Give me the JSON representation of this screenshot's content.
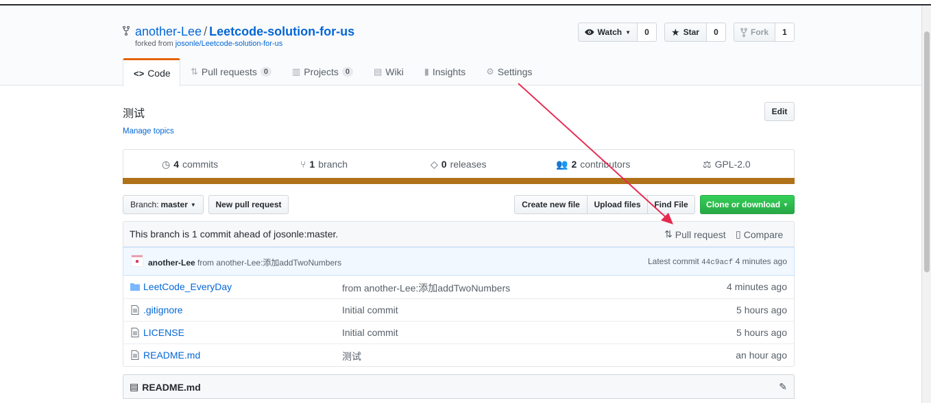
{
  "repo": {
    "owner": "another-Lee",
    "separator": "/",
    "name": "Leetcode-solution-for-us",
    "forked_prefix": "forked from",
    "forked_from": "josonle/Leetcode-solution-for-us"
  },
  "social": {
    "watch_label": "Watch",
    "watch_count": "0",
    "star_label": "Star",
    "star_count": "0",
    "fork_label": "Fork",
    "fork_count": "1"
  },
  "tabs": [
    {
      "label": "Code",
      "icon": "code-icon"
    },
    {
      "label": "Pull requests",
      "counter": "0",
      "icon": "pr-icon"
    },
    {
      "label": "Projects",
      "counter": "0",
      "icon": "project-icon"
    },
    {
      "label": "Wiki",
      "icon": "book-icon"
    },
    {
      "label": "Insights",
      "icon": "graph-icon"
    },
    {
      "label": "Settings",
      "icon": "gear-icon"
    }
  ],
  "description": "测试",
  "edit_label": "Edit",
  "manage_topics": "Manage topics",
  "summary": {
    "commits_count": "4",
    "commits_label": "commits",
    "branch_count": "1",
    "branch_label": "branch",
    "releases_count": "0",
    "releases_label": "releases",
    "contributors_count": "2",
    "contributors_label": "contributors",
    "license": "GPL-2.0"
  },
  "language_color": "#b07219",
  "toolbar": {
    "branch_prefix": "Branch:",
    "branch_name": "master",
    "new_pr": "New pull request",
    "create_file": "Create new file",
    "upload_files": "Upload files",
    "find_file": "Find File",
    "clone": "Clone or download"
  },
  "ahead": {
    "text": "This branch is 1 commit ahead of josonle:master.",
    "pull_request": "Pull request",
    "compare": "Compare"
  },
  "latest_commit": {
    "author": "another-Lee",
    "message": "from another-Lee:添加addTwoNumbers",
    "label": "Latest commit",
    "sha": "44c9acf",
    "age": "4 minutes ago"
  },
  "files": [
    {
      "type": "dir",
      "name": "LeetCode_EveryDay",
      "message": "from another-Lee:添加addTwoNumbers",
      "age": "4 minutes ago"
    },
    {
      "type": "file",
      "name": ".gitignore",
      "message": "Initial commit",
      "age": "5 hours ago"
    },
    {
      "type": "file",
      "name": "LICENSE",
      "message": "Initial commit",
      "age": "5 hours ago"
    },
    {
      "type": "file",
      "name": "README.md",
      "message": "测试",
      "age": "an hour ago"
    }
  ],
  "readme": {
    "title": "README.md"
  },
  "annotation_color": "#e8294f"
}
